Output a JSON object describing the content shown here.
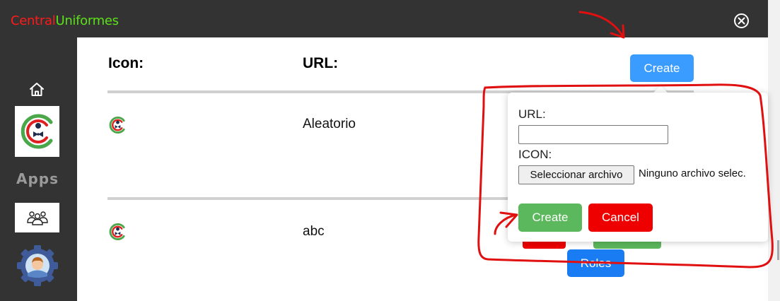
{
  "app": {
    "brand_part1": "Central",
    "brand_part2": "Uniformes"
  },
  "sidebar": {
    "apps_label": "Apps",
    "items": [
      {
        "icon": "home-icon"
      },
      {
        "icon": "central-uniformes-logo"
      },
      {
        "icon": "apps-label"
      },
      {
        "icon": "users-group-icon"
      },
      {
        "icon": "user-avatar-gear-icon"
      }
    ]
  },
  "table": {
    "headers": {
      "icon": "Icon:",
      "url": "URL:"
    },
    "rows": [
      {
        "icon": "central-uniformes-logo",
        "url": "Aleatorio"
      },
      {
        "icon": "central-uniformes-logo",
        "url": "abc"
      }
    ]
  },
  "toolbar": {
    "create_label": "Create"
  },
  "row_actions": {
    "roles_label": "Roles"
  },
  "popover": {
    "url_label": "URL:",
    "url_value": "",
    "icon_label": "ICON:",
    "file_button_label": "Seleccionar archivo",
    "file_status": "Ninguno archivo selec.",
    "create_label": "Create",
    "cancel_label": "Cancel"
  },
  "colors": {
    "topbar": "#333333",
    "brand_red": "#ff1a1a",
    "brand_green": "#5ce01a",
    "create_blue": "#3b9cff",
    "roles_blue": "#1a7cf2",
    "success_green": "#5cb85c",
    "danger_red": "#ee0000",
    "annotation_red": "#e01010"
  }
}
